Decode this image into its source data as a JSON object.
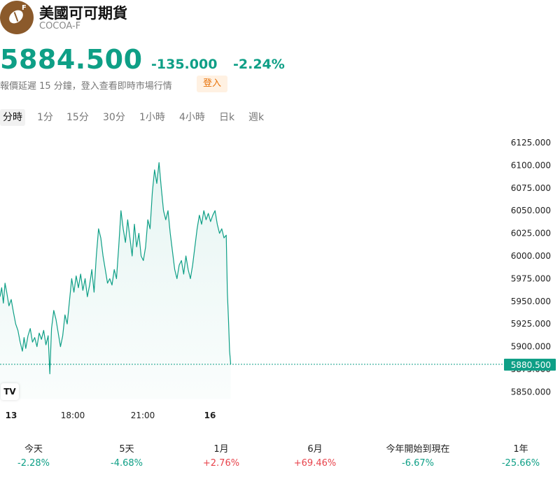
{
  "header": {
    "title": "美國可可期貨",
    "ticker": "COCOA-F",
    "logo_badge": "F",
    "logo_icon": "cocoa-bean-icon"
  },
  "quote": {
    "price": "5884.500",
    "change": "-135.000",
    "change_pct": "-2.24%",
    "delay_text": "報價延遲 15 分鐘，登入查看即時市場行情",
    "login_label": "登入"
  },
  "tabs": [
    {
      "label": "分時",
      "active": true
    },
    {
      "label": "1分",
      "active": false
    },
    {
      "label": "15分",
      "active": false
    },
    {
      "label": "30分",
      "active": false
    },
    {
      "label": "1小時",
      "active": false
    },
    {
      "label": "4小時",
      "active": false
    },
    {
      "label": "日k",
      "active": false
    },
    {
      "label": "週k",
      "active": false
    }
  ],
  "chart_data": {
    "type": "area",
    "y_ticks": [
      "6125.000",
      "6100.000",
      "6075.000",
      "6050.000",
      "6025.000",
      "6000.000",
      "5975.000",
      "5950.000",
      "5925.000",
      "5900.000",
      "5875.000",
      "5850.000"
    ],
    "ylim": [
      5850,
      6125
    ],
    "x_ticks": [
      {
        "label": "13",
        "bold": true,
        "x": 0.02
      },
      {
        "label": "18:00",
        "bold": false,
        "x": 0.13
      },
      {
        "label": "21:00",
        "bold": false,
        "x": 0.255
      },
      {
        "label": "16",
        "bold": true,
        "x": 0.375
      }
    ],
    "last_price_label": "5880.500",
    "last_price": 5880.5,
    "color": "#0e9f86",
    "points": [
      [
        0.0,
        5955
      ],
      [
        0.003,
        5965
      ],
      [
        0.006,
        5948
      ],
      [
        0.009,
        5970
      ],
      [
        0.012,
        5960
      ],
      [
        0.016,
        5945
      ],
      [
        0.02,
        5952
      ],
      [
        0.024,
        5938
      ],
      [
        0.028,
        5925
      ],
      [
        0.032,
        5918
      ],
      [
        0.036,
        5905
      ],
      [
        0.04,
        5895
      ],
      [
        0.043,
        5910
      ],
      [
        0.046,
        5898
      ],
      [
        0.05,
        5912
      ],
      [
        0.054,
        5920
      ],
      [
        0.058,
        5905
      ],
      [
        0.062,
        5910
      ],
      [
        0.066,
        5900
      ],
      [
        0.07,
        5915
      ],
      [
        0.074,
        5908
      ],
      [
        0.078,
        5918
      ],
      [
        0.082,
        5902
      ],
      [
        0.086,
        5912
      ],
      [
        0.089,
        5870
      ],
      [
        0.092,
        5920
      ],
      [
        0.096,
        5940
      ],
      [
        0.1,
        5930
      ],
      [
        0.104,
        5915
      ],
      [
        0.108,
        5900
      ],
      [
        0.112,
        5912
      ],
      [
        0.116,
        5935
      ],
      [
        0.12,
        5925
      ],
      [
        0.124,
        5950
      ],
      [
        0.128,
        5975
      ],
      [
        0.132,
        5960
      ],
      [
        0.136,
        5978
      ],
      [
        0.14,
        5965
      ],
      [
        0.144,
        5980
      ],
      [
        0.148,
        5962
      ],
      [
        0.152,
        5975
      ],
      [
        0.156,
        5955
      ],
      [
        0.16,
        5968
      ],
      [
        0.164,
        5985
      ],
      [
        0.168,
        5960
      ],
      [
        0.172,
        6000
      ],
      [
        0.176,
        6030
      ],
      [
        0.18,
        6020
      ],
      [
        0.184,
        6000
      ],
      [
        0.188,
        5985
      ],
      [
        0.192,
        5970
      ],
      [
        0.196,
        5975
      ],
      [
        0.2,
        5968
      ],
      [
        0.204,
        5985
      ],
      [
        0.208,
        5975
      ],
      [
        0.212,
        6010
      ],
      [
        0.216,
        6050
      ],
      [
        0.22,
        6030
      ],
      [
        0.224,
        6015
      ],
      [
        0.228,
        6040
      ],
      [
        0.232,
        6020
      ],
      [
        0.236,
        6000
      ],
      [
        0.24,
        6035
      ],
      [
        0.244,
        6010
      ],
      [
        0.248,
        6025
      ],
      [
        0.252,
        6000
      ],
      [
        0.256,
        5995
      ],
      [
        0.26,
        6010
      ],
      [
        0.264,
        6040
      ],
      [
        0.268,
        6030
      ],
      [
        0.272,
        6070
      ],
      [
        0.276,
        6095
      ],
      [
        0.28,
        6080
      ],
      [
        0.284,
        6103
      ],
      [
        0.288,
        6075
      ],
      [
        0.292,
        6050
      ],
      [
        0.296,
        6040
      ],
      [
        0.3,
        6050
      ],
      [
        0.304,
        6025
      ],
      [
        0.308,
        6005
      ],
      [
        0.312,
        5985
      ],
      [
        0.316,
        5975
      ],
      [
        0.32,
        5990
      ],
      [
        0.324,
        5995
      ],
      [
        0.328,
        5980
      ],
      [
        0.332,
        6000
      ],
      [
        0.336,
        5985
      ],
      [
        0.34,
        5975
      ],
      [
        0.344,
        5990
      ],
      [
        0.348,
        6010
      ],
      [
        0.352,
        6030
      ],
      [
        0.356,
        6045
      ],
      [
        0.36,
        6035
      ],
      [
        0.364,
        6050
      ],
      [
        0.368,
        6040
      ],
      [
        0.372,
        6047
      ],
      [
        0.376,
        6038
      ],
      [
        0.38,
        6045
      ],
      [
        0.384,
        6050
      ],
      [
        0.388,
        6035
      ],
      [
        0.392,
        6025
      ],
      [
        0.396,
        6030
      ],
      [
        0.4,
        6020
      ],
      [
        0.404,
        6023
      ],
      [
        0.406,
        5960
      ],
      [
        0.408,
        5930
      ],
      [
        0.41,
        5895
      ],
      [
        0.412,
        5880.5
      ]
    ]
  },
  "tv_badge": "TV",
  "performance": [
    {
      "label": "今天",
      "value": "-2.28%",
      "dir": "neg"
    },
    {
      "label": "5天",
      "value": "-4.68%",
      "dir": "neg"
    },
    {
      "label": "1月",
      "value": "+2.76%",
      "dir": "pos"
    },
    {
      "label": "6月",
      "value": "+69.46%",
      "dir": "pos"
    },
    {
      "label": "今年開始到現在",
      "value": "-6.67%",
      "dir": "neg"
    },
    {
      "label": "1年",
      "value": "-25.66%",
      "dir": "neg"
    }
  ]
}
